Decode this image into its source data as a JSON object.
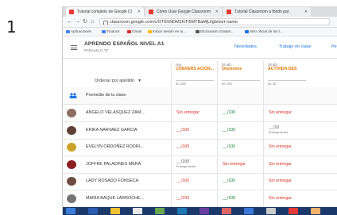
{
  "slide_number": "1",
  "browser": {
    "tabs": [
      {
        "label": "Tutorial completo de Google Cl",
        "icon_color": "#e53935"
      },
      {
        "label": "Cómo Usar Google Classroom",
        "icon_color": "#e53935"
      },
      {
        "label": "Tutorial Classroom a fondo par",
        "icon_color": "#e53935"
      }
    ],
    "url": "classroom.google.com/c/OTE5NDM1NTI5MTBaMjU/gb/sort-name",
    "bookmarks": [
      {
        "label": "Aplicaciones",
        "icon_color": "#4285f4"
      },
      {
        "label": "Traducir",
        "icon_color": "#4285f4"
      },
      {
        "label": "Gmail",
        "icon_color": "#d93025"
      },
      {
        "label": "Iniciar sesión en tu...",
        "icon_color": "#fbbc04"
      },
      {
        "label": "Diccionario Gratuit...",
        "icon_color": "#555555"
      },
      {
        "label": "Sitio oficial de las t...",
        "icon_color": "#1a73e8"
      }
    ]
  },
  "classroom": {
    "class_title": "APRENDO ESPAÑOL NIVEL A1",
    "class_subtitle": "PARALELO \"B\"",
    "nav_tabs": [
      "Novedades",
      "Trabajo en clase",
      "Pe"
    ],
    "sort_label": "Ordenar por apellido",
    "assignments": [
      {
        "date": "Hoy",
        "title": "CONVERS ACIÓN...",
        "points": "de 100"
      },
      {
        "date": "28 abr.",
        "title": "Oraciones",
        "points": "de 100"
      },
      {
        "date": "28 abr.",
        "title": "ACTIVIDA DES",
        "points": "de 10"
      }
    ],
    "average_label": "Promedio de la clase",
    "students": [
      {
        "name": "ANGELO VELASQUEZ ZAM...",
        "avatar_color": "#8d6e63",
        "grades": [
          {
            "value": "Sin entregar",
            "status": "red"
          },
          {
            "value": "__/100",
            "status": "green"
          },
          {
            "value": "Sin entregar",
            "status": "red"
          }
        ]
      },
      {
        "name": "ERIKA NARVAEZ GARCIA",
        "avatar_color": "#5d4037",
        "grades": [
          {
            "value": "__/100",
            "status": "red"
          },
          {
            "value": "__/100",
            "status": "green"
          },
          {
            "value": "__/10",
            "status": "plain",
            "note": "Entrega tardía"
          }
        ]
      },
      {
        "name": "EVELYN ORDOÑEZ RODRI...",
        "avatar_color": "#c9a227",
        "grades": [
          {
            "value": "__/100",
            "status": "red"
          },
          {
            "value": "__/100",
            "status": "green"
          },
          {
            "value": "Sin entregar",
            "status": "red"
          }
        ]
      },
      {
        "name": "JOFFRE PALADINES MERA",
        "avatar_color": "#8b1e1e",
        "grades": [
          {
            "value": "__/100",
            "status": "plain",
            "note": "Entrega tardía"
          },
          {
            "value": "Sin entregar",
            "status": "red"
          },
          {
            "value": "Sin entregar",
            "status": "red"
          }
        ]
      },
      {
        "name": "LADY ROSADO FONSECA",
        "avatar_color": "#6d4c41",
        "grades": [
          {
            "value": "__/100",
            "status": "red"
          },
          {
            "value": "__/100",
            "status": "green"
          },
          {
            "value": "Sin entregar",
            "status": "red"
          }
        ]
      },
      {
        "name": "MARIA BAQUE LARROCHE...",
        "avatar_color": "#757575",
        "grades": [
          {
            "value": "__/100",
            "status": "red"
          },
          {
            "value": "__/100",
            "status": "green"
          },
          {
            "value": "Sin entregar",
            "status": "red"
          }
        ]
      }
    ]
  },
  "taskbar": {
    "icon_colors": [
      "#3b7dd8",
      "#2a5db0",
      "#f1c232",
      "#e8e8e8",
      "#6aa84f",
      "#1f77b4",
      "#6b3fa0",
      "#e06666",
      "#3c78d8",
      "#cccccc",
      "#e53935",
      "#f6b26b"
    ]
  }
}
